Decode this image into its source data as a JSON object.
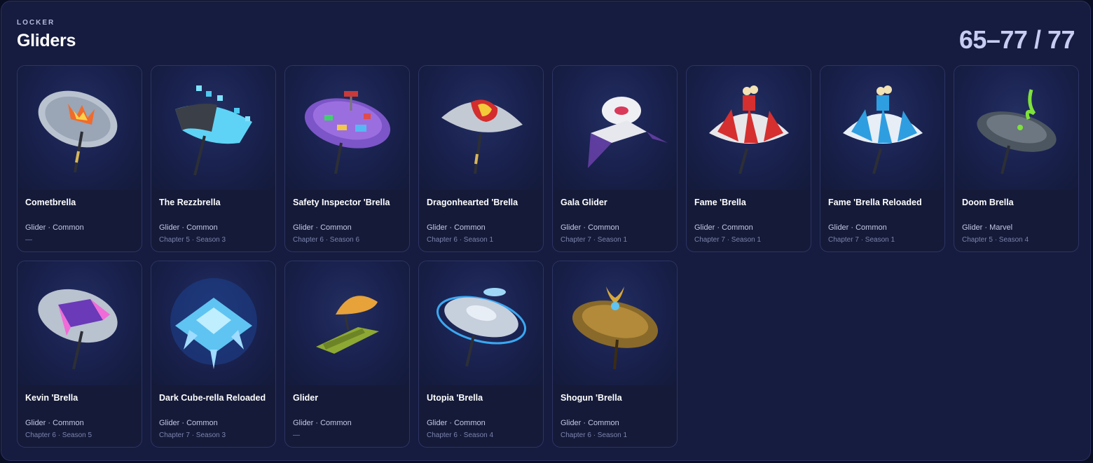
{
  "header": {
    "kicker": "LOCKER",
    "title": "Gliders",
    "count": "65–77 / 77"
  },
  "items": [
    {
      "name": "Cometbrella",
      "meta": "Glider · Common",
      "sub": "—",
      "icon": "cometbrella-icon"
    },
    {
      "name": "The Rezzbrella",
      "meta": "Glider · Common",
      "sub": "Chapter 5 · Season 3",
      "icon": "rezzbrella-icon"
    },
    {
      "name": "Safety Inspector 'Brella",
      "meta": "Glider · Common",
      "sub": "Chapter 6 · Season 6",
      "icon": "safety-inspector-brella-icon"
    },
    {
      "name": "Dragonhearted 'Brella",
      "meta": "Glider · Common",
      "sub": "Chapter 6 · Season 1",
      "icon": "dragonhearted-brella-icon"
    },
    {
      "name": "Gala Glider",
      "meta": "Glider · Common",
      "sub": "Chapter 7 · Season 1",
      "icon": "gala-glider-icon"
    },
    {
      "name": "Fame 'Brella",
      "meta": "Glider · Common",
      "sub": "Chapter 7 · Season 1",
      "icon": "fame-brella-icon"
    },
    {
      "name": "Fame 'Brella Reloaded",
      "meta": "Glider · Common",
      "sub": "Chapter 7 · Season 1",
      "icon": "fame-brella-reloaded-icon"
    },
    {
      "name": "Doom Brella",
      "meta": "Glider · Marvel",
      "sub": "Chapter 5 · Season 4",
      "icon": "doom-brella-icon"
    },
    {
      "name": "Kevin 'Brella",
      "meta": "Glider · Common",
      "sub": "Chapter 6 · Season 5",
      "icon": "kevin-brella-icon"
    },
    {
      "name": "Dark Cube-rella Reloaded",
      "meta": "Glider · Common",
      "sub": "Chapter 7 · Season 3",
      "icon": "dark-cube-rella-icon"
    },
    {
      "name": "Glider",
      "meta": "Glider · Common",
      "sub": "—",
      "icon": "glider-icon"
    },
    {
      "name": "Utopia 'Brella",
      "meta": "Glider · Common",
      "sub": "Chapter 6 · Season 4",
      "icon": "utopia-brella-icon"
    },
    {
      "name": "Shogun 'Brella",
      "meta": "Glider · Common",
      "sub": "Chapter 6 · Season 1",
      "icon": "shogun-brella-icon"
    }
  ]
}
